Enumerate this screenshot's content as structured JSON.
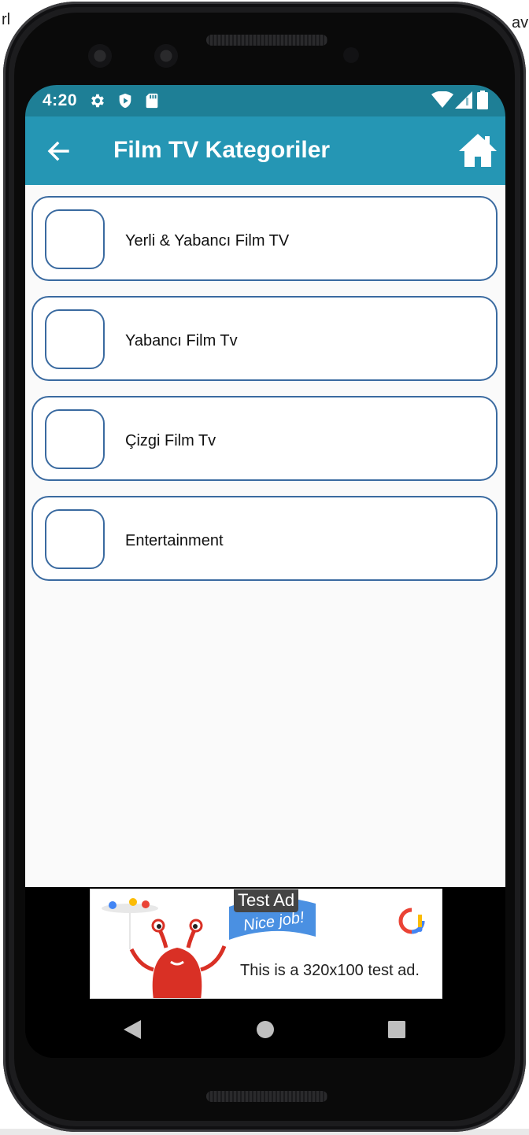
{
  "background": {
    "left_fragment": "rl",
    "right_fragment": "av"
  },
  "status_bar": {
    "time": "4:20",
    "icons": [
      "settings-icon",
      "shield-play-icon",
      "sd-card-icon",
      "wifi-icon",
      "signal-icon",
      "battery-icon"
    ]
  },
  "app_bar": {
    "title": "Film TV Kategoriler",
    "back_icon": "arrow-back-icon",
    "home_icon": "home-icon"
  },
  "categories": [
    {
      "label": "Yerli & Yabancı Film TV"
    },
    {
      "label": "Yabancı Film Tv"
    },
    {
      "label": "Çizgi Film Tv"
    },
    {
      "label": "Entertainment"
    }
  ],
  "ad": {
    "badge": "Test Ad",
    "banner_text": "Nice job!",
    "body": "This is a 320x100 test ad."
  },
  "nav_bar": {
    "buttons": [
      "back-triangle-icon",
      "home-circle-icon",
      "recents-square-icon"
    ]
  },
  "colors": {
    "status_bar": "#1e7f96",
    "app_bar": "#2596b4",
    "card_border": "#3a6aa0"
  }
}
